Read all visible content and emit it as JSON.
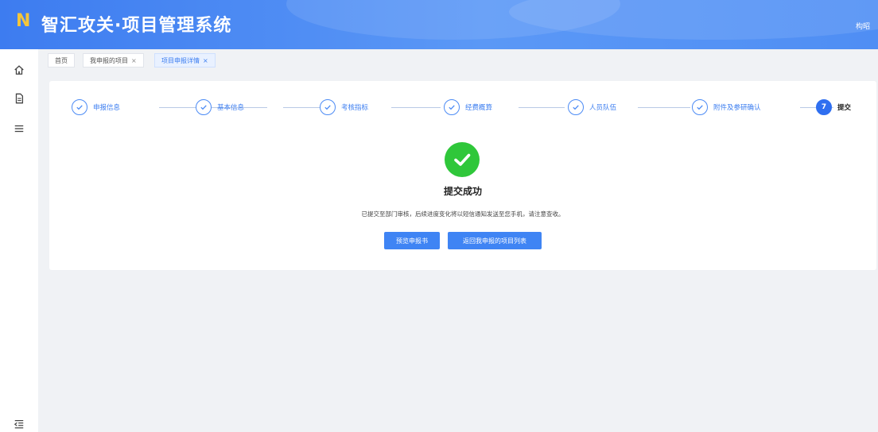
{
  "header": {
    "logo_text": "N",
    "title": "智汇攻关·项目管理系统",
    "user_name": "构昭"
  },
  "sidebar": {
    "items": [
      {
        "icon": "home-icon"
      },
      {
        "icon": "document-icon"
      },
      {
        "icon": "menu-icon"
      },
      {
        "icon": "collapse-icon"
      }
    ]
  },
  "tabs": [
    {
      "label": "首页",
      "closable": false,
      "active": false
    },
    {
      "label": "我申报的项目",
      "closable": true,
      "active": false
    },
    {
      "label": "项目申报详情",
      "closable": true,
      "active": true
    }
  ],
  "tab_close_glyph": "×",
  "steps": [
    {
      "label": "申报信息",
      "status": "done"
    },
    {
      "label": "基本信息",
      "status": "done"
    },
    {
      "label": "考核指标",
      "status": "done"
    },
    {
      "label": "经费概算",
      "status": "done"
    },
    {
      "label": "人员队伍",
      "status": "done"
    },
    {
      "label": "附件及参研确认",
      "status": "done"
    },
    {
      "label": "提交",
      "status": "current",
      "number": "7"
    }
  ],
  "result": {
    "title": "提交成功",
    "description": "已提交至部门审核，后续进度变化将以短信通知发送至您手机，请注意查收。"
  },
  "buttons": {
    "preview": "预览申报书",
    "back_to_list": "返回我申报的项目列表"
  },
  "colors": {
    "header_primary": "#3d7cf0",
    "accent": "#3b7df0",
    "success": "#2fc73a",
    "logo": "#f4c63a"
  }
}
